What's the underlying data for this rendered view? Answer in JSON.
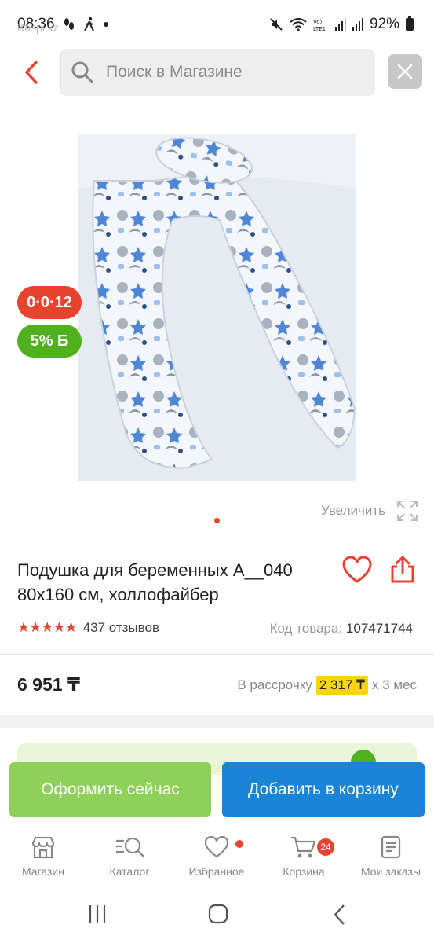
{
  "status": {
    "time": "08:36",
    "ghost_app": "Kaspi.kz",
    "battery": "92%"
  },
  "search": {
    "placeholder": "Поиск в Магазине"
  },
  "product": {
    "badge_installment": "0·0·12",
    "badge_bonus": "5% Б",
    "zoom_label": "Увеличить",
    "title": "Подушка для беременных A__040 80х160 см, холлофайбер",
    "rating_stars": "★★★★★",
    "reviews": "437 отзывов",
    "code_label": "Код товара:",
    "code_value": "107471744",
    "price": "6 951 ₸",
    "installment_prefix": "В рассрочку",
    "installment_amount": "2 317 ₸",
    "installment_suffix": "х 3 мес"
  },
  "actions": {
    "buy_now": "Оформить сейчас",
    "add_to_cart": "Добавить в корзину"
  },
  "tabs": [
    {
      "label": "Магазин",
      "icon": "store-icon"
    },
    {
      "label": "Каталог",
      "icon": "catalog-icon"
    },
    {
      "label": "Избранное",
      "icon": "heart-icon"
    },
    {
      "label": "Корзина",
      "icon": "cart-icon",
      "badge": "24"
    },
    {
      "label": "Мои заказы",
      "icon": "orders-icon"
    }
  ],
  "colors": {
    "brand_red": "#e8432f",
    "green": "#50b11f",
    "blue": "#1a84d6",
    "yellow": "#fad50c"
  }
}
